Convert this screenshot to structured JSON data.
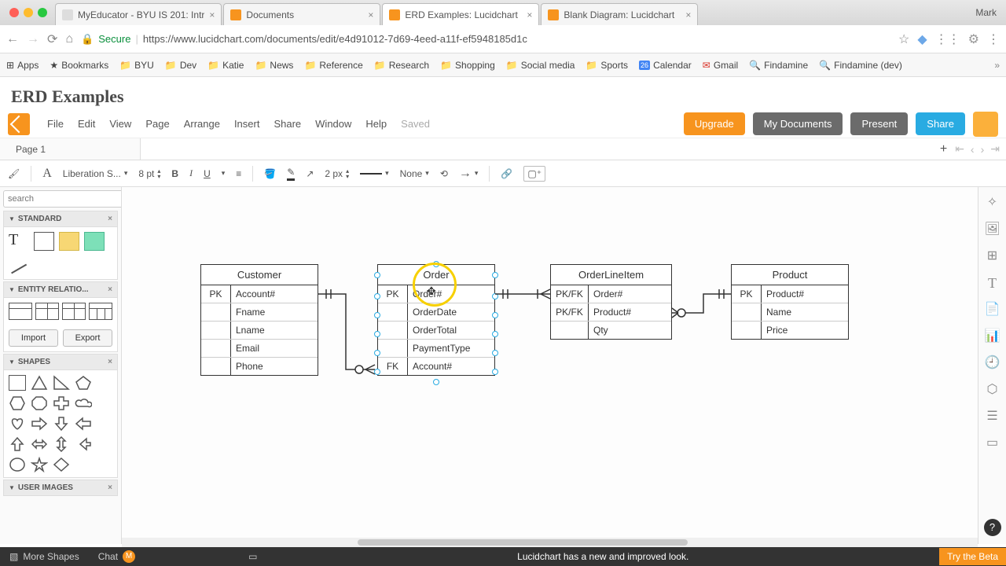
{
  "browser": {
    "profile": "Mark",
    "tabs": [
      {
        "title": "MyEducator - BYU IS 201: Intr",
        "active": false
      },
      {
        "title": "Documents",
        "active": false
      },
      {
        "title": "ERD Examples: Lucidchart",
        "active": true
      },
      {
        "title": "Blank Diagram: Lucidchart",
        "active": false
      }
    ],
    "secure_label": "Secure",
    "url": "https://www.lucidchart.com/documents/edit/e4d91012-7d69-4eed-a11f-ef5948185d1c"
  },
  "bookmarks": [
    "Apps",
    "Bookmarks",
    "BYU",
    "Dev",
    "Katie",
    "News",
    "Reference",
    "Research",
    "Shopping",
    "Social media",
    "Sports",
    "Calendar",
    "Gmail",
    "Findamine",
    "Findamine (dev)"
  ],
  "calendar_badge": "26",
  "doc": {
    "title": "ERD Examples"
  },
  "menu": {
    "items": [
      "File",
      "Edit",
      "View",
      "Page",
      "Arrange",
      "Insert",
      "Share",
      "Window",
      "Help"
    ],
    "status": "Saved",
    "upgrade": "Upgrade",
    "my_docs": "My Documents",
    "present": "Present",
    "share": "Share"
  },
  "pages": {
    "tab": "Page 1"
  },
  "toolbar": {
    "font": "Liberation S...",
    "font_size": "8 pt",
    "stroke": "2 px",
    "line_end": "None"
  },
  "left": {
    "search_placeholder": "search",
    "standard": "STANDARD",
    "entity": "ENTITY RELATIO...",
    "import": "Import",
    "export": "Export",
    "shapes": "SHAPES",
    "user_images": "USER IMAGES"
  },
  "entities": {
    "customer": {
      "title": "Customer",
      "rows": [
        {
          "key": "PK",
          "attr": "Account#"
        },
        {
          "key": "",
          "attr": "Fname"
        },
        {
          "key": "",
          "attr": "Lname"
        },
        {
          "key": "",
          "attr": "Email"
        },
        {
          "key": "",
          "attr": "Phone"
        }
      ]
    },
    "order": {
      "title": "Order",
      "rows": [
        {
          "key": "PK",
          "attr": "Order#"
        },
        {
          "key": "",
          "attr": "OrderDate"
        },
        {
          "key": "",
          "attr": "OrderTotal"
        },
        {
          "key": "",
          "attr": "PaymentType"
        },
        {
          "key": "FK",
          "attr": "Account#"
        }
      ]
    },
    "orderline": {
      "title": "OrderLineItem",
      "rows": [
        {
          "key": "PK/FK",
          "attr": "Order#"
        },
        {
          "key": "PK/FK",
          "attr": "Product#"
        },
        {
          "key": "",
          "attr": "Qty"
        }
      ]
    },
    "product": {
      "title": "Product",
      "rows": [
        {
          "key": "PK",
          "attr": "Product#"
        },
        {
          "key": "",
          "attr": "Name"
        },
        {
          "key": "",
          "attr": "Price"
        }
      ]
    }
  },
  "bottom": {
    "more_shapes": "More Shapes",
    "chat": "Chat",
    "chat_badge": "M",
    "banner": "Lucidchart has a new and improved look.",
    "beta": "Try the Beta"
  }
}
